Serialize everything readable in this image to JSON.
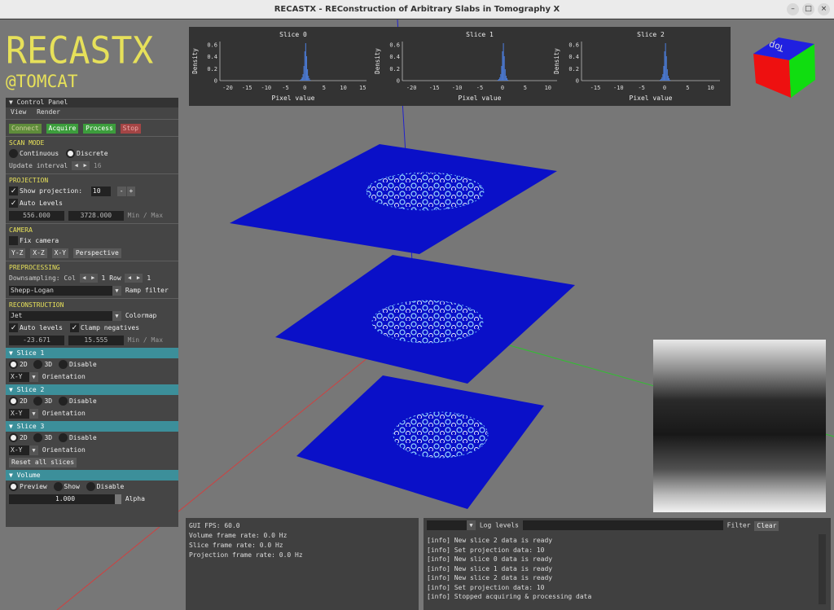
{
  "window": {
    "title": "RECASTX - REConstruction of Arbitrary Slabs in Tomography X"
  },
  "logo": {
    "main": "RECASTX",
    "sub": "@TOMCAT"
  },
  "control_panel": {
    "header": "Control Panel",
    "menu": [
      "View",
      "Render"
    ],
    "actions": {
      "connect": "Connect",
      "acquire": "Acquire",
      "process": "Process",
      "stop": "Stop"
    },
    "scan_mode": {
      "title": "SCAN MODE",
      "continuous": "Continuous",
      "discrete": "Discrete",
      "update_interval_label": "Update interval",
      "update_interval_value": "16"
    },
    "projection": {
      "title": "PROJECTION",
      "show_label": "Show projection:",
      "show_value": "10",
      "minus": "-",
      "plus": "+",
      "auto_levels": "Auto Levels",
      "min": "556.000",
      "max": "3728.000",
      "minmax_label": "Min / Max"
    },
    "camera": {
      "title": "CAMERA",
      "fix_camera": "Fix camera",
      "views": [
        "Y-Z",
        "X-Z",
        "X-Y",
        "Perspective"
      ]
    },
    "preprocessing": {
      "title": "PREPROCESSING",
      "downsampling_label": "Downsampling: Col",
      "col_value": "1",
      "row_label": "Row",
      "row_value": "1",
      "filter_value": "Shepp-Logan",
      "filter_label": "Ramp filter"
    },
    "reconstruction": {
      "title": "RECONSTRUCTION",
      "colormap_value": "Jet",
      "colormap_label": "Colormap",
      "auto_levels": "Auto levels",
      "clamp_negatives": "Clamp negatives",
      "min": "-23.671",
      "max": "15.555",
      "minmax_label": "Min / Max"
    },
    "slices": [
      {
        "header": "Slice 1",
        "opt_2d": "2D",
        "opt_3d": "3D",
        "opt_disable": "Disable",
        "orientation_value": "X-Y",
        "orientation_label": "Orientation"
      },
      {
        "header": "Slice 2",
        "opt_2d": "2D",
        "opt_3d": "3D",
        "opt_disable": "Disable",
        "orientation_value": "X-Y",
        "orientation_label": "Orientation"
      },
      {
        "header": "Slice 3",
        "opt_2d": "2D",
        "opt_3d": "3D",
        "opt_disable": "Disable",
        "orientation_value": "X-Y",
        "orientation_label": "Orientation"
      }
    ],
    "reset_slices": "Reset all slices",
    "volume": {
      "header": "Volume",
      "preview": "Preview",
      "show": "Show",
      "disable": "Disable",
      "alpha_value": "1.000",
      "alpha_label": "Alpha"
    }
  },
  "histograms": [
    {
      "title": "Slice 0",
      "ylabel": "Density",
      "xlabel": "Pixel value",
      "xticks": [
        "-20",
        "-15",
        "-10",
        "-5",
        "0",
        "5",
        "10",
        "15"
      ],
      "yticks": [
        "0",
        "0.2",
        "0.4",
        "0.6"
      ]
    },
    {
      "title": "Slice 1",
      "ylabel": "Density",
      "xlabel": "Pixel value",
      "xticks": [
        "-20",
        "-15",
        "-10",
        "-5",
        "0",
        "5",
        "10"
      ],
      "yticks": [
        "0",
        "0.2",
        "0.4",
        "0.6"
      ]
    },
    {
      "title": "Slice 2",
      "ylabel": "Density",
      "xlabel": "Pixel value",
      "xticks": [
        "-15",
        "-10",
        "-5",
        "0",
        "5",
        "10"
      ],
      "yticks": [
        "0",
        "0.2",
        "0.4",
        "0.6"
      ]
    }
  ],
  "orientation_cube": {
    "top_label": "Top"
  },
  "stats": {
    "gui_fps": "GUI FPS: 60.0",
    "volume_rate": "Volume frame rate: 0.0 Hz",
    "slice_rate": "Slice frame rate: 0.0 Hz",
    "projection_rate": "Projection frame rate: 0.0 Hz"
  },
  "log": {
    "levels_label": "Log levels",
    "filter_label": "Filter",
    "clear": "Clear",
    "lines": [
      "[info] New slice 2 data is ready",
      "[info] Set projection data: 10",
      "[info] New slice 0 data is ready",
      "[info] New slice 1 data is ready",
      "[info] New slice 2 data is ready",
      "[info] Set projection data: 10",
      "[info] Stopped acquiring & processing data"
    ]
  },
  "colors": {
    "accent_yellow": "#e6e05a",
    "teal": "#3c8f9a",
    "slice_blue": "#0a10c8",
    "green_btn": "#3c9d3c",
    "stop_red": "#a34545"
  }
}
